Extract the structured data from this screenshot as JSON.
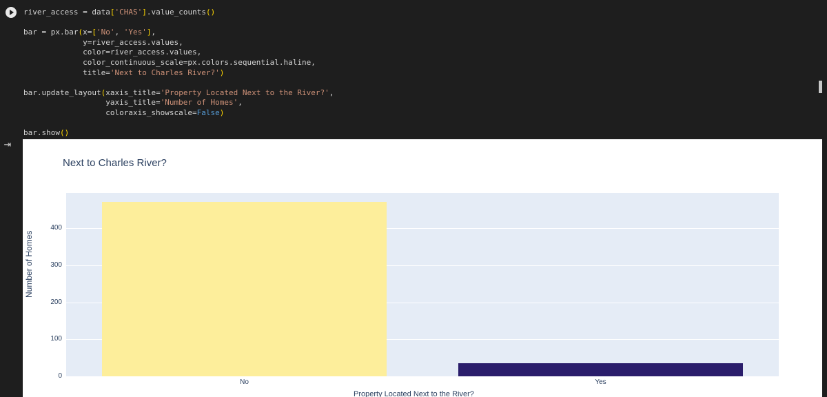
{
  "code": {
    "lines": [
      "river_access = data['CHAS'].value_counts()",
      "",
      "bar = px.bar(x=['No', 'Yes'],",
      "             y=river_access.values,",
      "             color=river_access.values,",
      "             color_continuous_scale=px.colors.sequential.haline,",
      "             title='Next to Charles River?')",
      "",
      "bar.update_layout(xaxis_title='Property Located Next to the River?',",
      "                  yaxis_title='Number of Homes',",
      "                  coloraxis_showscale=False)",
      "",
      "bar.show()"
    ]
  },
  "output": {
    "toggle_icon": "output-toggle-icon"
  },
  "chart_data": {
    "type": "bar",
    "title": "Next to Charles River?",
    "categories": [
      "No",
      "Yes"
    ],
    "values": [
      471,
      35
    ],
    "xlabel": "Property Located Next to the River?",
    "ylabel": "Number of Homes",
    "ylim": [
      0,
      495
    ],
    "yticks": [
      0,
      100,
      200,
      300,
      400
    ],
    "grid": true,
    "bar_colors": [
      "#fdee9b",
      "#2a1d6b"
    ],
    "plot_bgcolor": "#e5ecf6",
    "text_color": "#2a3f5f"
  }
}
